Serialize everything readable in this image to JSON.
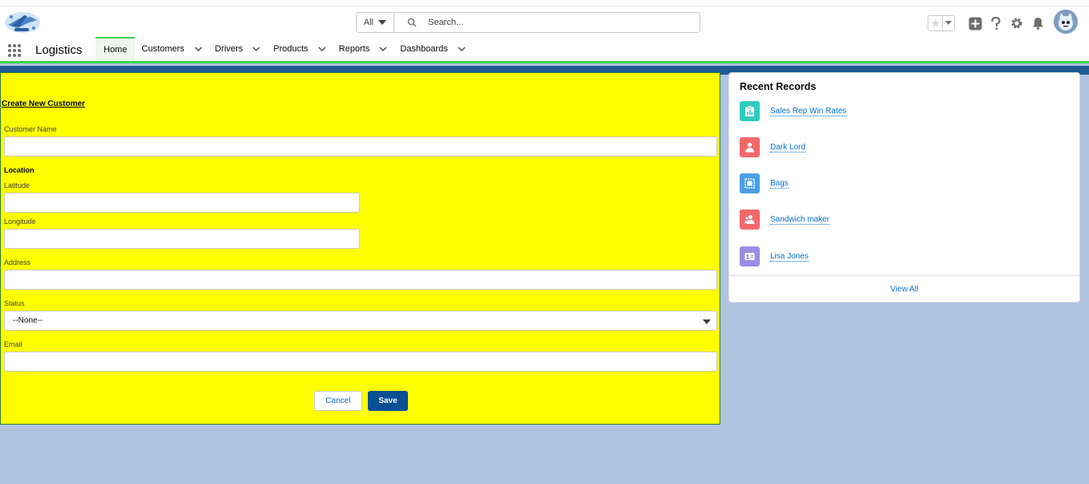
{
  "colors": {
    "nav_accent": "#39d353",
    "form_background": "#ffff00",
    "page_background": "#b0c4df",
    "save_button": "#0b4f94",
    "link": "#0070d2"
  },
  "header": {
    "search_scope": "All",
    "search_placeholder": "Search..."
  },
  "nav": {
    "app_name": "Logistics",
    "items": [
      {
        "label": "Home",
        "active": true
      },
      {
        "label": "Customers"
      },
      {
        "label": "Drivers"
      },
      {
        "label": "Products"
      },
      {
        "label": "Reports"
      },
      {
        "label": "Dashboards"
      }
    ]
  },
  "form": {
    "title": "Create New Customer",
    "customer_name_label": "Customer Name",
    "location_label": "Location",
    "latitude_label": "Latitude",
    "longitude_label": "Longitude",
    "address_label": "Address",
    "status_label": "Status",
    "status_value": "--None--",
    "email_label": "Email",
    "cancel_label": "Cancel",
    "save_label": "Save"
  },
  "recent_records": {
    "title": "Recent Records",
    "items": [
      {
        "label": "Sales Rep Win Rates",
        "icon": "report-icon",
        "color": "#2ecbbe"
      },
      {
        "label": "Dark Lord",
        "icon": "contact-icon",
        "color": "#f2696b"
      },
      {
        "label": "Bags",
        "icon": "product-icon",
        "color": "#4aa0e6"
      },
      {
        "label": "Sandwich maker",
        "icon": "lead-icon",
        "color": "#f2696b"
      },
      {
        "label": "Lisa Jones",
        "icon": "contact-card-icon",
        "color": "#9b8ce6"
      }
    ],
    "view_all_label": "View All"
  }
}
